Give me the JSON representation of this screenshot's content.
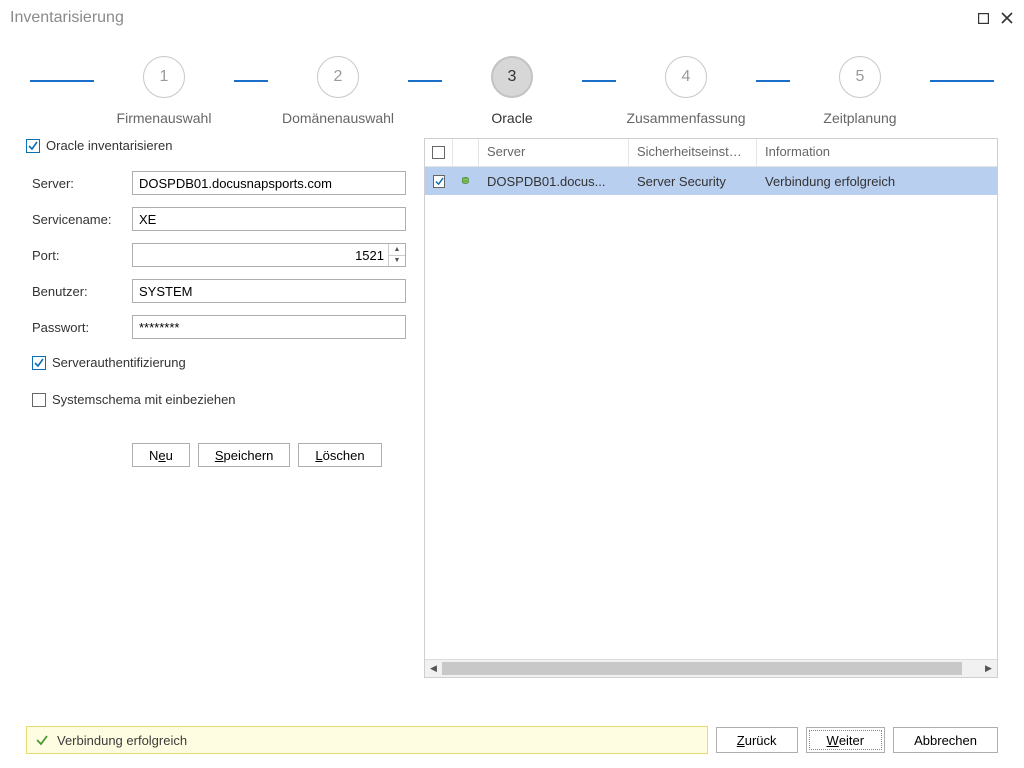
{
  "window": {
    "title": "Inventarisierung"
  },
  "wizard": {
    "steps": [
      {
        "num": "1",
        "label": "Firmenauswahl"
      },
      {
        "num": "2",
        "label": "Domänenauswahl"
      },
      {
        "num": "3",
        "label": "Oracle"
      },
      {
        "num": "4",
        "label": "Zusammenfassung"
      },
      {
        "num": "5",
        "label": "Zeitplanung"
      }
    ],
    "active_index": 2
  },
  "form": {
    "oracle_inventory_label": "Oracle inventarisieren",
    "oracle_inventory_checked": true,
    "server_label": "Server:",
    "server_value": "DOSPDB01.docusnapsports.com",
    "servicename_label": "Servicename:",
    "servicename_value": "XE",
    "port_label": "Port:",
    "port_value": "1521",
    "user_label": "Benutzer:",
    "user_value": "SYSTEM",
    "password_label": "Passwort:",
    "password_value": "********",
    "server_auth_label": "Serverauthentifizierung",
    "server_auth_checked": true,
    "system_schema_label": "Systemschema mit einbeziehen",
    "system_schema_checked": false,
    "btn_new_pre": "N",
    "btn_new_accel": "e",
    "btn_new_post": "u",
    "btn_save_pre": "",
    "btn_save_accel": "S",
    "btn_save_post": "peichern",
    "btn_delete_pre": "",
    "btn_delete_accel": "L",
    "btn_delete_post": "öschen"
  },
  "grid": {
    "headers": {
      "server": "Server",
      "security": "Sicherheitseinstellun...",
      "info": "Information"
    },
    "rows": [
      {
        "checked": true,
        "server": "DOSPDB01.docus...",
        "security": "Server Security",
        "info": "Verbindung erfolgreich"
      }
    ]
  },
  "status": {
    "text": "Verbindung erfolgreich"
  },
  "footer": {
    "back_pre": "",
    "back_accel": "Z",
    "back_post": "urück",
    "next_pre": "",
    "next_accel": "W",
    "next_post": "eiter",
    "cancel": "Abbrechen"
  }
}
